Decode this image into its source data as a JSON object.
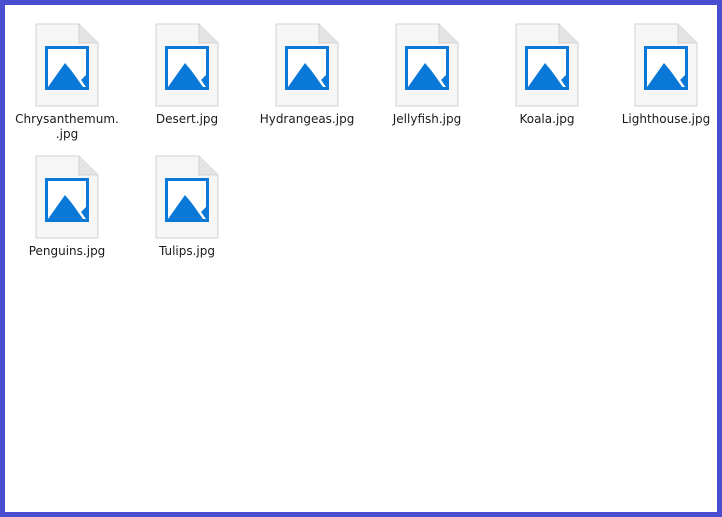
{
  "files": [
    {
      "name": "Chrysanthemum.\n.jpg",
      "icon": "image-file-icon"
    },
    {
      "name": "Desert.jpg",
      "icon": "image-file-icon"
    },
    {
      "name": "Hydrangeas.jpg",
      "icon": "image-file-icon"
    },
    {
      "name": "Jellyfish.jpg",
      "icon": "image-file-icon"
    },
    {
      "name": "Koala.jpg",
      "icon": "image-file-icon"
    },
    {
      "name": "Lighthouse.jpg",
      "icon": "image-file-icon"
    },
    {
      "name": "Penguins.jpg",
      "icon": "image-file-icon"
    },
    {
      "name": "Tulips.jpg",
      "icon": "image-file-icon"
    }
  ],
  "colors": {
    "border": "#4a4fd1",
    "icon_accent": "#0a78d7",
    "page_fill": "#f6f6f6",
    "page_fold": "#dcdcdc"
  }
}
